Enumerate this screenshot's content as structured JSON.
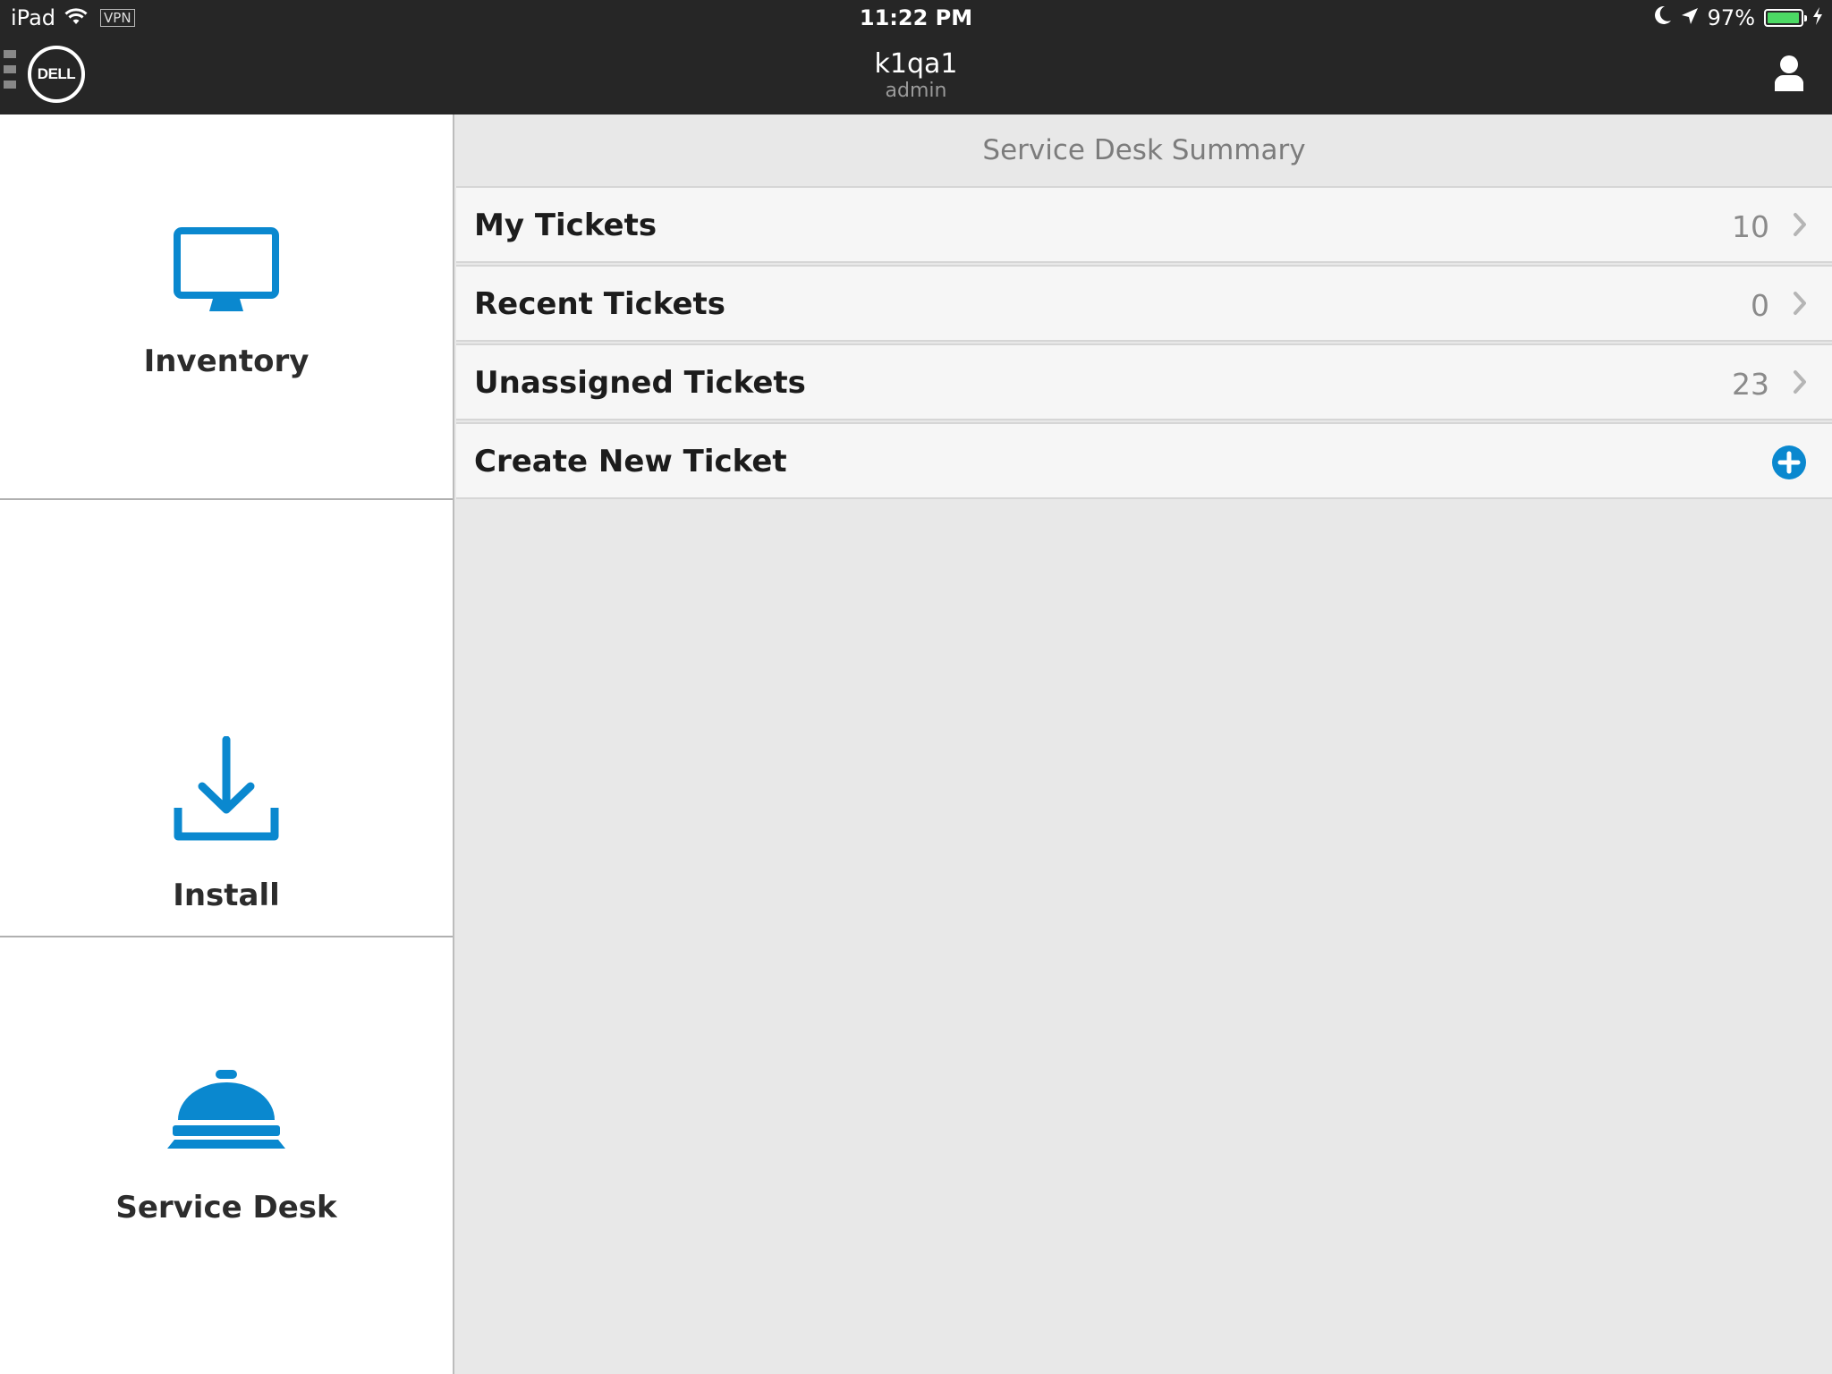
{
  "status_bar": {
    "device": "iPad",
    "vpn": "VPN",
    "time": "11:22 PM",
    "battery_percent_label": "97%",
    "battery_level": 0.97
  },
  "nav": {
    "title": "k1qa1",
    "subtitle": "admin",
    "logo_text": "DELL"
  },
  "modules": [
    {
      "label": "Inventory",
      "icon": "monitor-icon"
    },
    {
      "label": "Install",
      "icon": "download-icon"
    },
    {
      "label": "Service Desk",
      "icon": "service-bell-icon"
    }
  ],
  "summary": {
    "title": "Service Desk Summary",
    "rows": [
      {
        "label": "My Tickets",
        "count": "10",
        "action": "chevron-right-icon"
      },
      {
        "label": "Recent Tickets",
        "count": "0",
        "action": "chevron-right-icon"
      },
      {
        "label": "Unassigned Tickets",
        "count": "23",
        "action": "chevron-right-icon"
      },
      {
        "label": "Create New Ticket",
        "count": "",
        "action": "plus-circle-icon"
      }
    ]
  },
  "colors": {
    "accent": "#0a88cf",
    "topbar": "#262626",
    "battery": "#4cd964"
  }
}
